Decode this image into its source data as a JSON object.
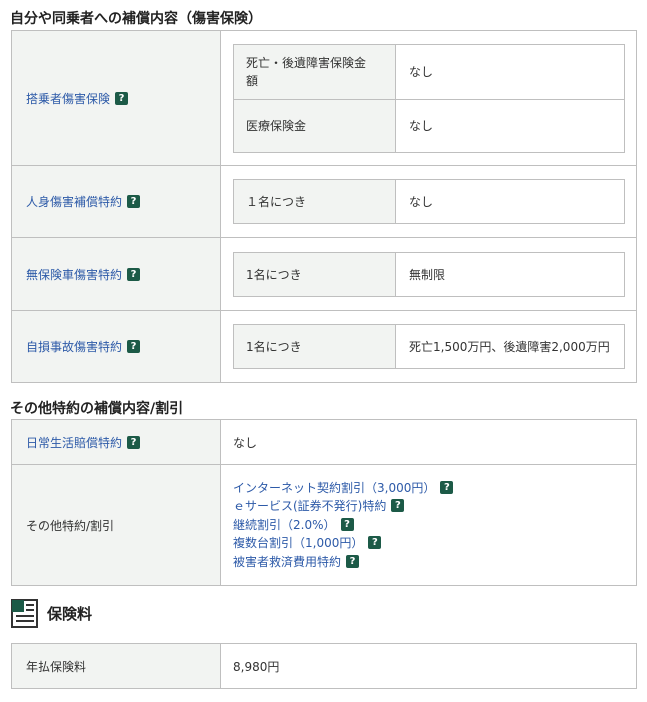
{
  "section1": {
    "title": "自分や同乗者への補償内容（傷害保険）",
    "rows": [
      {
        "label": "搭乗者傷害保険",
        "items": [
          {
            "label": "死亡・後遺障害保険金額",
            "value": "なし"
          },
          {
            "label": "医療保険金",
            "value": "なし"
          }
        ]
      },
      {
        "label": "人身傷害補償特約",
        "items": [
          {
            "label": "１名につき",
            "value": "なし"
          }
        ]
      },
      {
        "label": "無保険車傷害特約",
        "items": [
          {
            "label": "1名につき",
            "value": "無制限"
          }
        ]
      },
      {
        "label": "自損事故傷害特約",
        "items": [
          {
            "label": "1名につき",
            "value": "死亡1,500万円、後遺障害2,000万円"
          }
        ]
      }
    ]
  },
  "section2": {
    "title": "その他特約の補償内容/割引",
    "daily": {
      "label": "日常生活賠償特約",
      "value": "なし"
    },
    "other": {
      "label": "その他特約/割引",
      "items": [
        "インターネット契約割引（3,000円）",
        "ｅサービス(証券不発行)特約",
        "継続割引（2.0%）",
        "複数台割引（1,000円）",
        "被害者救済費用特約"
      ]
    }
  },
  "premium": {
    "title": "保険料",
    "label": "年払保険料",
    "value": "8,980円"
  },
  "help_icon_glyph": "?",
  "colors": {
    "link": "#2d5aa8",
    "help_badge": "#1c5a47",
    "label_bg": "#f2f4f2",
    "border": "#bfbfbf"
  }
}
